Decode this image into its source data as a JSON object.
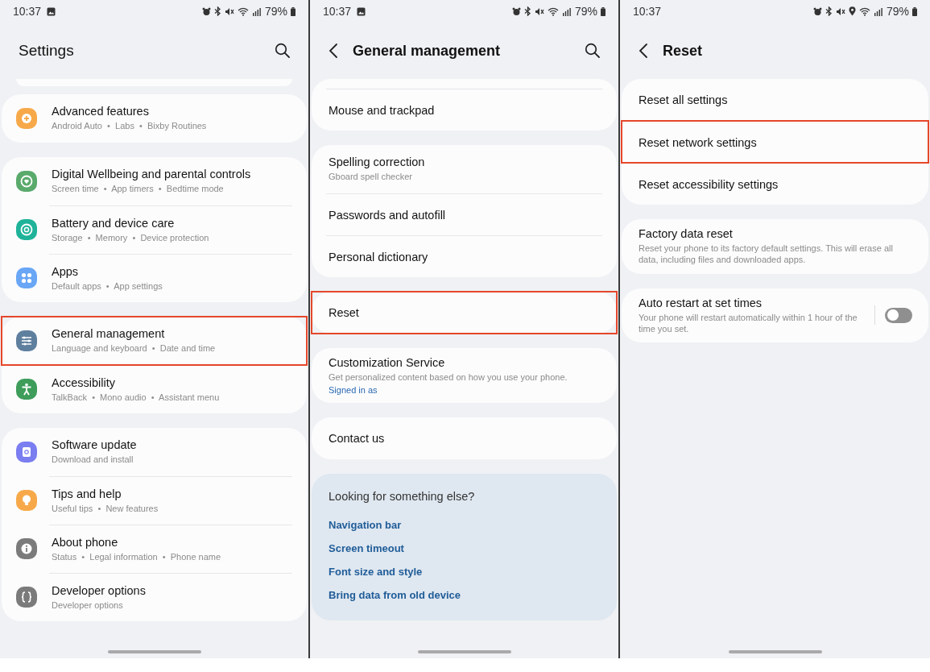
{
  "screens": [
    {
      "status_bar": {
        "time": "10:37",
        "battery": "79%"
      },
      "header": {
        "title": "Settings",
        "back": false,
        "search": true
      },
      "top_sliver": true,
      "groups": [
        {
          "items": [
            {
              "title": "Advanced features",
              "subtitle": "Android Auto  •  Labs  •  Bixby Routines",
              "color": "#f7a94a",
              "highlighted": false
            }
          ]
        },
        {
          "items": [
            {
              "title": "Digital Wellbeing and parental controls",
              "subtitle": "Screen time  •  App timers  •  Bedtime mode",
              "color": "#5aaa6c",
              "highlighted": false
            },
            {
              "title": "Battery and device care",
              "subtitle": "Storage  •  Memory  •  Device protection",
              "color": "#1fb39a",
              "highlighted": false
            },
            {
              "title": "Apps",
              "subtitle": "Default apps  •  App settings",
              "color": "#69a6f5",
              "highlighted": false
            }
          ]
        },
        {
          "items": [
            {
              "title": "General management",
              "subtitle": "Language and keyboard  •  Date and time",
              "color": "#5f7f9e",
              "highlighted": true
            },
            {
              "title": "Accessibility",
              "subtitle": "TalkBack  •  Mono audio  •  Assistant menu",
              "color": "#3e9d5a",
              "highlighted": false
            }
          ]
        },
        {
          "items": [
            {
              "title": "Software update",
              "subtitle": "Download and install",
              "color": "#7a7ef0",
              "highlighted": false
            },
            {
              "title": "Tips and help",
              "subtitle": "Useful tips  •  New features",
              "color": "#f7a94a",
              "highlighted": false
            },
            {
              "title": "About phone",
              "subtitle": "Status  •  Legal information  •  Phone name",
              "color": "#7b7b7b",
              "highlighted": false
            },
            {
              "title": "Developer options",
              "subtitle": "Developer options",
              "color": "#7b7b7b",
              "highlighted": false
            }
          ]
        }
      ]
    },
    {
      "status_bar": {
        "time": "10:37",
        "battery": "79%"
      },
      "header": {
        "title": "General management",
        "back": true,
        "search": true
      },
      "top_sliver": false,
      "groups": [
        {
          "clipped": true,
          "items": [
            {
              "title": "Mouse and trackpad",
              "highlighted": false
            }
          ]
        },
        {
          "items": [
            {
              "title": "Spelling correction",
              "subtitle": "Gboard spell checker",
              "highlighted": false
            },
            {
              "title": "Passwords and autofill",
              "highlighted": false
            },
            {
              "title": "Personal dictionary",
              "highlighted": false
            }
          ]
        },
        {
          "items": [
            {
              "title": "Reset",
              "highlighted": true
            }
          ]
        },
        {
          "items": [
            {
              "title": "Customization Service",
              "subtitle": "Get personalized content based on how you use your phone.",
              "link": "Signed in as",
              "highlighted": false
            }
          ]
        },
        {
          "items": [
            {
              "title": "Contact us",
              "highlighted": false
            }
          ]
        }
      ],
      "suggestions": {
        "heading": "Looking for something else?",
        "links": [
          "Navigation bar",
          "Screen timeout",
          "Font size and style",
          "Bring data from old device"
        ]
      }
    },
    {
      "status_bar": {
        "time": "10:37",
        "battery": "79%"
      },
      "header": {
        "title": "Reset",
        "back": true,
        "search": false
      },
      "top_sliver": false,
      "groups": [
        {
          "items": [
            {
              "title": "Reset all settings",
              "highlighted": false
            },
            {
              "title": "Reset network settings",
              "highlighted": true
            },
            {
              "title": "Reset accessibility settings",
              "highlighted": false
            }
          ]
        },
        {
          "items": [
            {
              "title": "Factory data reset",
              "subtitle": "Reset your phone to its factory default settings. This will erase all data, including files and downloaded apps.",
              "highlighted": false
            }
          ]
        },
        {
          "items": [
            {
              "title": "Auto restart at set times",
              "subtitle": "Your phone will restart automatically within 1 hour of the time you set.",
              "toggle": {
                "on": false
              },
              "highlighted": false
            }
          ]
        }
      ]
    }
  ]
}
